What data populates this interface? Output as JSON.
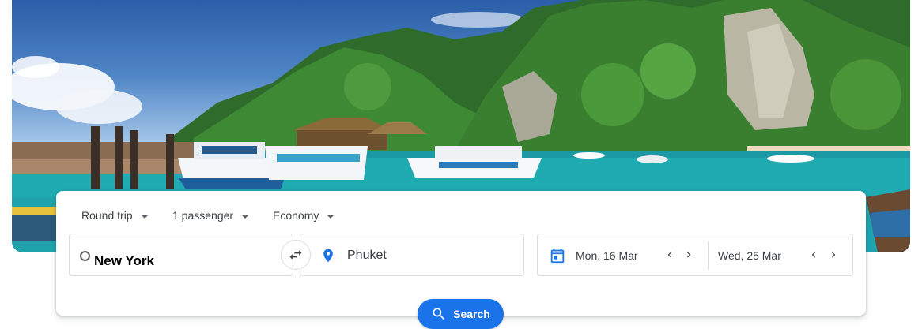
{
  "trip": {
    "type_label": "Round trip",
    "passengers_label": "1 passenger",
    "class_label": "Economy"
  },
  "route": {
    "origin": "New York",
    "destination": "Phuket"
  },
  "dates": {
    "departure": "Mon, 16 Mar",
    "return": "Wed, 25 Mar"
  },
  "search": {
    "label": "Search"
  },
  "icons": {
    "origin": "origin-circle-icon",
    "destination": "location-pin-icon",
    "swap": "swap-arrows-icon",
    "calendar": "calendar-icon",
    "search": "search-icon"
  },
  "colors": {
    "accent": "#1a73e8",
    "text": "#3c4043",
    "border": "#dadce0"
  }
}
